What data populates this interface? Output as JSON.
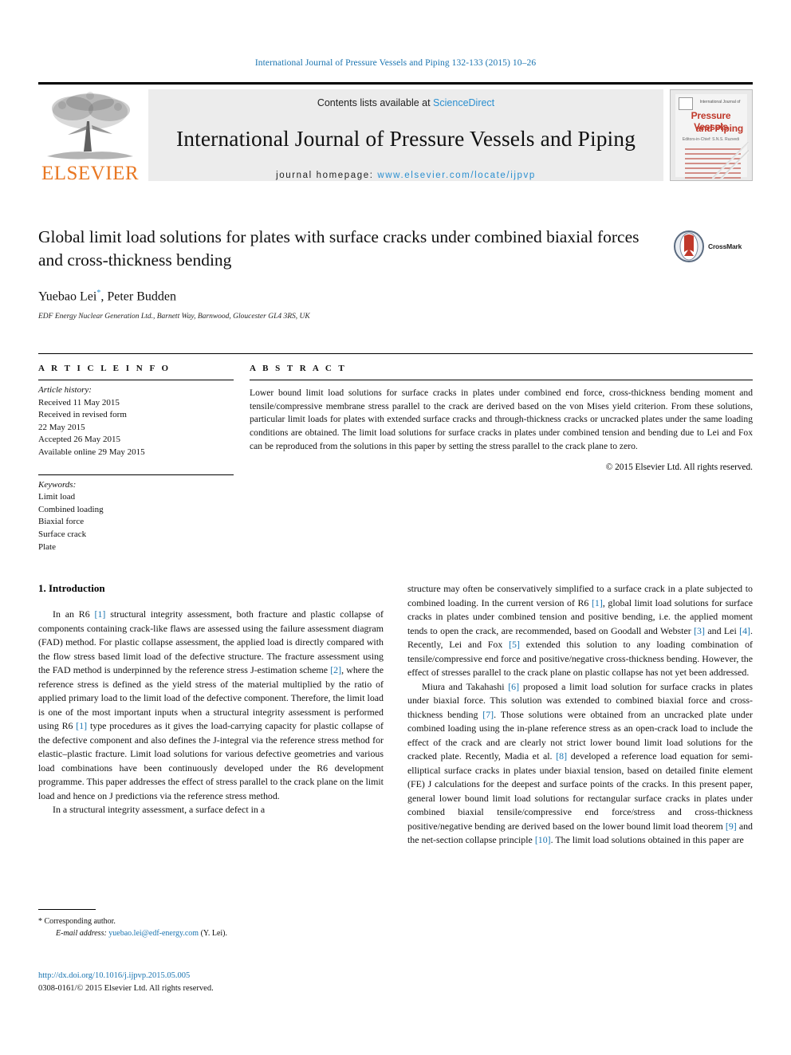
{
  "running_head": "International Journal of Pressure Vessels and Piping 132-133 (2015) 10–26",
  "masthead": {
    "publisher_name": "ELSEVIER",
    "contents_prefix": "Contents lists available at ",
    "contents_link": "ScienceDirect",
    "journal_title": "International Journal of Pressure Vessels and Piping",
    "homepage_prefix": "journal homepage: ",
    "homepage_url": "www.elsevier.com/locate/ijpvp",
    "cover": {
      "eyebrow": "International Journal of",
      "line1": "Pressure Vessels",
      "line2": "and Piping",
      "editor": "Editors-in-Chief: S.N.S. Ruzvedi"
    }
  },
  "article": {
    "title": "Global limit load solutions for plates with surface cracks under combined biaxial forces and cross-thickness bending",
    "authors": "Yuebao Lei",
    "authors_marker": "*",
    "authors_rest": ", Peter Budden",
    "affiliation": "EDF Energy Nuclear Generation Ltd., Barnett Way, Barnwood, Gloucester GL4 3RS, UK",
    "crossmark_label": "CrossMark"
  },
  "info": {
    "heading": "A R T I C L E   I N F O",
    "history_label": "Article history:",
    "history": [
      "Received 11 May 2015",
      "Received in revised form",
      "22 May 2015",
      "Accepted 26 May 2015",
      "Available online 29 May 2015"
    ],
    "keywords_label": "Keywords:",
    "keywords": [
      "Limit load",
      "Combined loading",
      "Biaxial force",
      "Surface crack",
      "Plate"
    ]
  },
  "abstract": {
    "heading": "A B S T R A C T",
    "text": "Lower bound limit load solutions for surface cracks in plates under combined end force, cross-thickness bending moment and tensile/compressive membrane stress parallel to the crack are derived based on the von Mises yield criterion. From these solutions, particular limit loads for plates with extended surface cracks and through-thickness cracks or uncracked plates under the same loading conditions are obtained. The limit load solutions for surface cracks in plates under combined tension and bending due to Lei and Fox can be reproduced from the solutions in this paper by setting the stress parallel to the crack plane to zero.",
    "copyright": "© 2015 Elsevier Ltd. All rights reserved."
  },
  "body": {
    "section_number": "1.",
    "section_title": "Introduction",
    "left_paragraphs": [
      {
        "parts": [
          {
            "t": "In an R6 ",
            "k": "text"
          },
          {
            "t": "[1]",
            "k": "ref"
          },
          {
            "t": " structural integrity assessment, both fracture and plastic collapse of components containing crack-like flaws are assessed using the failure assessment diagram (FAD) method. For plastic collapse assessment, the applied load is directly compared with the flow stress based limit load of the defective structure. The fracture assessment using the FAD method is underpinned by the reference stress J-estimation scheme ",
            "k": "text"
          },
          {
            "t": "[2]",
            "k": "ref"
          },
          {
            "t": ", where the reference stress is defined as the yield stress of the material multiplied by the ratio of applied primary load to the limit load of the defective component. Therefore, the limit load is one of the most important inputs when a structural integrity assessment is performed using R6 ",
            "k": "text"
          },
          {
            "t": "[1]",
            "k": "ref"
          },
          {
            "t": " type procedures as it gives the load-carrying capacity for plastic collapse of the defective component and also defines the J-integral via the reference stress method for elastic–plastic fracture. Limit load solutions for various defective geometries and various load combinations have been continuously developed under the R6 development programme. This paper addresses the effect of stress parallel to the crack plane on the limit load and hence on J predictions via the reference stress method.",
            "k": "text"
          }
        ]
      },
      {
        "parts": [
          {
            "t": "In a structural integrity assessment, a surface defect in a",
            "k": "text"
          }
        ]
      }
    ],
    "right_paragraphs": [
      {
        "indent": false,
        "parts": [
          {
            "t": "structure may often be conservatively simplified to a surface crack in a plate subjected to combined loading. In the current version of R6 ",
            "k": "text"
          },
          {
            "t": "[1]",
            "k": "ref"
          },
          {
            "t": ", global limit load solutions for surface cracks in plates under combined tension and positive bending, i.e. the applied moment tends to open the crack, are recommended, based on Goodall and Webster ",
            "k": "text"
          },
          {
            "t": "[3]",
            "k": "ref"
          },
          {
            "t": " and Lei ",
            "k": "text"
          },
          {
            "t": "[4]",
            "k": "ref"
          },
          {
            "t": ". Recently, Lei and Fox ",
            "k": "text"
          },
          {
            "t": "[5]",
            "k": "ref"
          },
          {
            "t": " extended this solution to any loading combination of tensile/compressive end force and positive/negative cross-thickness bending. However, the effect of stresses parallel to the crack plane on plastic collapse has not yet been addressed.",
            "k": "text"
          }
        ]
      },
      {
        "indent": true,
        "parts": [
          {
            "t": "Miura and Takahashi ",
            "k": "text"
          },
          {
            "t": "[6]",
            "k": "ref"
          },
          {
            "t": " proposed a limit load solution for surface cracks in plates under biaxial force. This solution was extended to combined biaxial force and cross-thickness bending ",
            "k": "text"
          },
          {
            "t": "[7]",
            "k": "ref"
          },
          {
            "t": ". Those solutions were obtained from an uncracked plate under combined loading using the in-plane reference stress as an open-crack load to include the effect of the crack and are clearly not strict lower bound limit load solutions for the cracked plate. Recently, Madia et al. ",
            "k": "text"
          },
          {
            "t": "[8]",
            "k": "ref"
          },
          {
            "t": " developed a reference load equation for semi-elliptical surface cracks in plates under biaxial tension, based on detailed finite element (FE) J calculations for the deepest and surface points of the cracks. In this present paper, general lower bound limit load solutions for rectangular surface cracks in plates under combined biaxial tensile/compressive end force/stress and cross-thickness positive/negative bending are derived based on the lower bound limit load theorem ",
            "k": "text"
          },
          {
            "t": "[9]",
            "k": "ref"
          },
          {
            "t": " and the net-section collapse principle ",
            "k": "text"
          },
          {
            "t": "[10]",
            "k": "ref"
          },
          {
            "t": ". The limit load solutions obtained in this paper are",
            "k": "text"
          }
        ]
      }
    ]
  },
  "footnote": {
    "corresponding": "* Corresponding author.",
    "email_label": "E-mail address:",
    "email": "yuebao.lei@edf-energy.com",
    "email_suffix": " (Y. Lei)."
  },
  "doi": {
    "url": "http://dx.doi.org/10.1016/j.ijpvp.2015.05.005",
    "issn_line": "0308-0161/© 2015 Elsevier Ltd. All rights reserved."
  },
  "colors": {
    "link": "#1a74b0",
    "sciencedirect": "#2a8fd0",
    "elsevier_orange": "#E87722",
    "cover_red": "#c0392b",
    "crossmark_red": "#c0392b",
    "band_gray": "#ececec"
  }
}
